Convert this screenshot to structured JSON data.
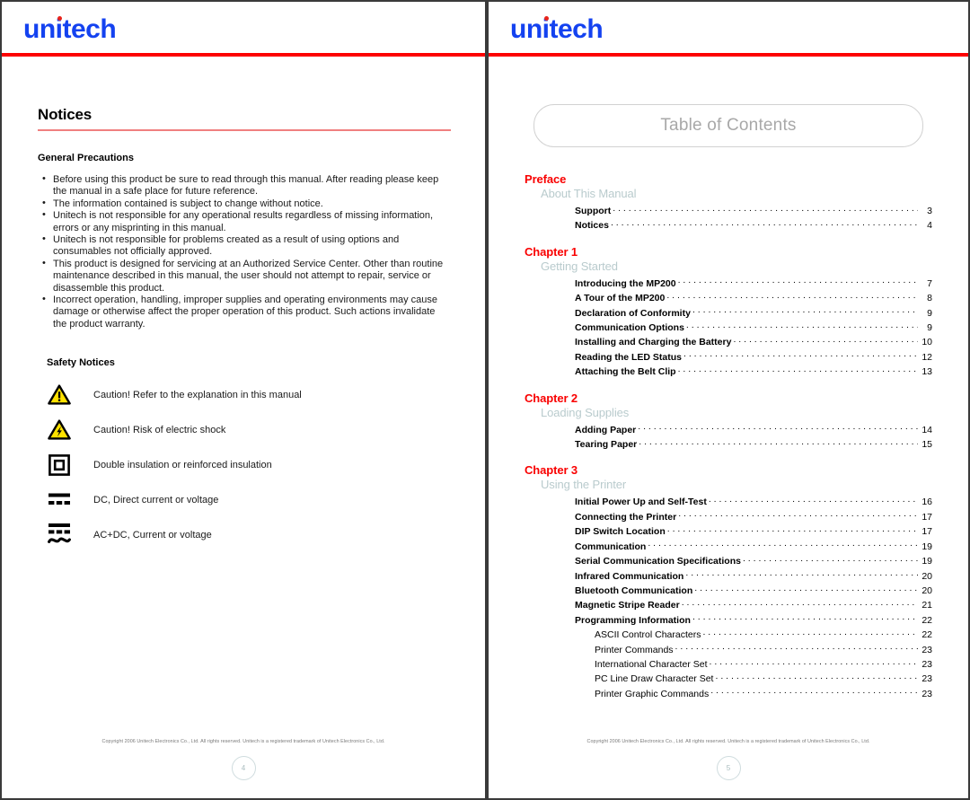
{
  "brand": {
    "logo_text": "unitech",
    "logo_color": "#1442f0",
    "accent_red": "#fd0000"
  },
  "left_page": {
    "heading": "Notices",
    "general_precautions": {
      "subhead": "General Precautions",
      "items": [
        "Before using this product be sure to read through this manual. After reading please keep the manual in a safe place for future reference.",
        "The information contained is subject to change without notice.",
        "Unitech is not responsible for any operational results regardless of missing information, errors or any misprinting in this manual.",
        "Unitech is not responsible for problems created as a result of using options and consumables not officially approved.",
        "This product is designed for servicing at an Authorized Service Center. Other than routine maintenance described in this manual, the user should not attempt to repair, service or disassemble this product.",
        "Incorrect operation, handling, improper supplies and operating environments may cause damage or otherwise affect the proper operation of this product. Such actions invalidate the product warranty."
      ]
    },
    "safety_notices": {
      "subhead": "Safety Notices",
      "items": [
        {
          "icon": "warning-triangle-exclamation-icon",
          "text": "Caution!  Refer to the explanation in this manual"
        },
        {
          "icon": "warning-triangle-lightning-icon",
          "text": "Caution!  Risk of electric shock"
        },
        {
          "icon": "double-insulation-square-icon",
          "text": "Double insulation or reinforced insulation"
        },
        {
          "icon": "dc-current-icon",
          "text": "DC, Direct current or voltage"
        },
        {
          "icon": "ac-dc-current-icon",
          "text": "AC+DC, Current or voltage"
        }
      ]
    },
    "footer": {
      "copyright": "Copyright 2006 Unitech Electronics Co., Ltd. All rights reserved. Unitech is a registered trademark of Unitech Electronics Co., Ltd.",
      "page_number": "4"
    }
  },
  "right_page": {
    "banner_title": "Table of Contents",
    "parts": [
      {
        "chapter": "Preface",
        "section": "About This Manual",
        "entries": [
          {
            "label": "Support",
            "page": "3",
            "level": 1
          },
          {
            "label": "Notices",
            "page": "4",
            "level": 1
          }
        ]
      },
      {
        "chapter": "Chapter 1",
        "section": "Getting Started",
        "entries": [
          {
            "label": "Introducing the MP200",
            "page": "7",
            "level": 1
          },
          {
            "label": "A Tour of the MP200",
            "page": "8",
            "level": 1
          },
          {
            "label": "Declaration of Conformity",
            "page": "9",
            "level": 1
          },
          {
            "label": "Communication Options",
            "page": "9",
            "level": 1
          },
          {
            "label": "Installing and Charging the Battery",
            "page": "10",
            "level": 1
          },
          {
            "label": "Reading the LED Status",
            "page": "12",
            "level": 1
          },
          {
            "label": "Attaching the Belt Clip",
            "page": "13",
            "level": 1
          }
        ]
      },
      {
        "chapter": "Chapter 2",
        "section": "Loading Supplies",
        "entries": [
          {
            "label": "Adding Paper",
            "page": "14",
            "level": 1
          },
          {
            "label": "Tearing Paper",
            "page": "15",
            "level": 1
          }
        ]
      },
      {
        "chapter": "Chapter 3",
        "section": "Using the Printer",
        "entries": [
          {
            "label": "Initial Power Up and Self-Test",
            "page": "16",
            "level": 1
          },
          {
            "label": "Connecting the Printer",
            "page": "17",
            "level": 1
          },
          {
            "label": "DIP Switch Location",
            "page": "17",
            "level": 1
          },
          {
            "label": "Communication",
            "page": "19",
            "level": 1
          },
          {
            "label": "Serial Communication Specifications",
            "page": "19",
            "level": 1
          },
          {
            "label": "Infrared Communication",
            "page": "20",
            "level": 1
          },
          {
            "label": "Bluetooth Communication",
            "page": "20",
            "level": 1
          },
          {
            "label": "Magnetic Stripe Reader",
            "page": "21",
            "level": 1
          },
          {
            "label": "Programming Information",
            "page": "22",
            "level": 1
          },
          {
            "label": "ASCII Control Characters",
            "page": "22",
            "level": 2
          },
          {
            "label": "Printer Commands",
            "page": "23",
            "level": 2
          },
          {
            "label": "International Character Set",
            "page": "23",
            "level": 2
          },
          {
            "label": "PC Line Draw Character Set",
            "page": "23",
            "level": 2
          },
          {
            "label": "Printer Graphic Commands",
            "page": "23",
            "level": 2
          }
        ]
      }
    ],
    "footer": {
      "copyright": "Copyright 2006 Unitech Electronics Co., Ltd. All rights reserved. Unitech is a registered trademark of Unitech Electronics Co., Ltd.",
      "page_number": "5"
    }
  }
}
